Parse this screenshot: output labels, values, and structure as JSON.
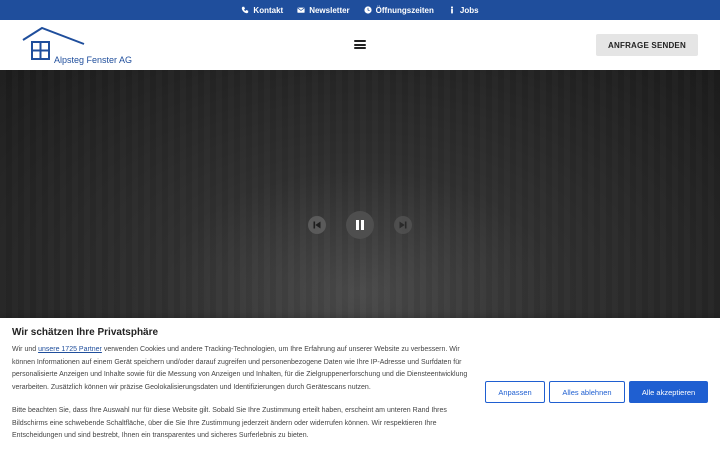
{
  "topbar": {
    "links": [
      {
        "label": "Kontakt",
        "icon": "phone-icon"
      },
      {
        "label": "Newsletter",
        "icon": "envelope-icon"
      },
      {
        "label": "Öffnungszeiten",
        "icon": "clock-icon"
      },
      {
        "label": "Jobs",
        "icon": "person-icon"
      }
    ]
  },
  "header": {
    "logo_text": "Alpsteg Fenster AG",
    "cta_label": "ANFRAGE SENDEN"
  },
  "colors": {
    "brand_blue": "#1f4e9c",
    "button_blue": "#1f5fd1",
    "cta_gray": "#e5e5e5"
  },
  "consent": {
    "title": "Wir schätzen Ihre Privatsphäre",
    "p1_before": "Wir und ",
    "p1_link": "unsere 1725 Partner",
    "p1_after": " verwenden Cookies und andere Tracking-Technologien, um Ihre Erfahrung auf unserer Website zu verbessern. Wir können Informationen auf einem Gerät speichern und/oder darauf zugreifen und personenbezogene Daten wie Ihre IP-Adresse und Surfdaten für personalisierte Anzeigen und Inhalte sowie für die Messung von Anzeigen und Inhalten, für die Zielgruppenerforschung und die Diensteentwicklung verarbeiten. Zusätzlich können wir präzise Geolokalisierungsdaten und Identifizierungen durch Gerätescans nutzen.",
    "p2": "Bitte beachten Sie, dass Ihre Auswahl nur für diese Website gilt. Sobald Sie Ihre Zustimmung erteilt haben, erscheint am unteren Rand Ihres Bildschirms eine schwebende Schaltfläche, über die Sie Ihre Zustimmung jederzeit ändern oder widerrufen können. Wir respektieren Ihre Entscheidungen und sind bestrebt, Ihnen ein transparentes und sicheres Surferlebnis zu bieten.",
    "buttons": {
      "adjust": "Anpassen",
      "reject": "Alles ablehnen",
      "accept": "Alle akzeptieren"
    }
  }
}
